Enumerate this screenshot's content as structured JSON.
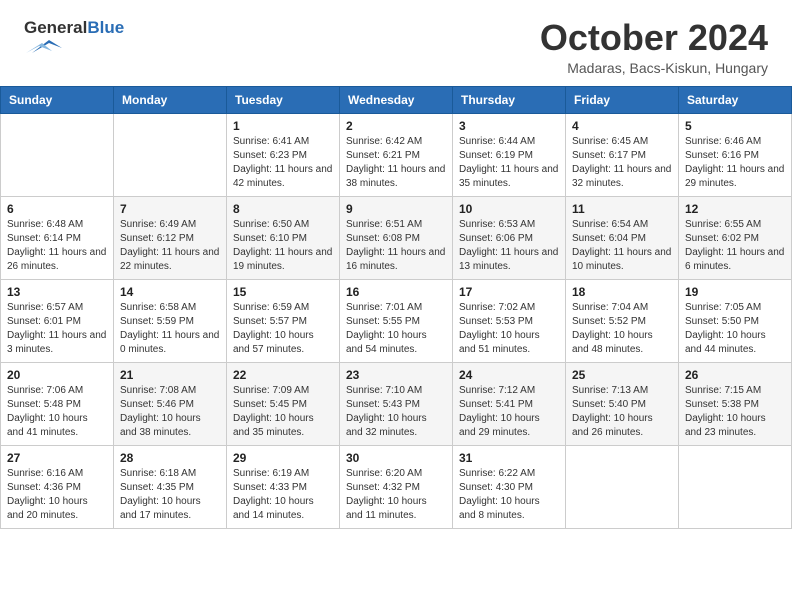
{
  "header": {
    "logo_general": "General",
    "logo_blue": "Blue",
    "month": "October 2024",
    "location": "Madaras, Bacs-Kiskun, Hungary"
  },
  "days_of_week": [
    "Sunday",
    "Monday",
    "Tuesday",
    "Wednesday",
    "Thursday",
    "Friday",
    "Saturday"
  ],
  "weeks": [
    [
      {
        "num": "",
        "sunrise": "",
        "sunset": "",
        "daylight": ""
      },
      {
        "num": "",
        "sunrise": "",
        "sunset": "",
        "daylight": ""
      },
      {
        "num": "1",
        "sunrise": "Sunrise: 6:41 AM",
        "sunset": "Sunset: 6:23 PM",
        "daylight": "Daylight: 11 hours and 42 minutes."
      },
      {
        "num": "2",
        "sunrise": "Sunrise: 6:42 AM",
        "sunset": "Sunset: 6:21 PM",
        "daylight": "Daylight: 11 hours and 38 minutes."
      },
      {
        "num": "3",
        "sunrise": "Sunrise: 6:44 AM",
        "sunset": "Sunset: 6:19 PM",
        "daylight": "Daylight: 11 hours and 35 minutes."
      },
      {
        "num": "4",
        "sunrise": "Sunrise: 6:45 AM",
        "sunset": "Sunset: 6:17 PM",
        "daylight": "Daylight: 11 hours and 32 minutes."
      },
      {
        "num": "5",
        "sunrise": "Sunrise: 6:46 AM",
        "sunset": "Sunset: 6:16 PM",
        "daylight": "Daylight: 11 hours and 29 minutes."
      }
    ],
    [
      {
        "num": "6",
        "sunrise": "Sunrise: 6:48 AM",
        "sunset": "Sunset: 6:14 PM",
        "daylight": "Daylight: 11 hours and 26 minutes."
      },
      {
        "num": "7",
        "sunrise": "Sunrise: 6:49 AM",
        "sunset": "Sunset: 6:12 PM",
        "daylight": "Daylight: 11 hours and 22 minutes."
      },
      {
        "num": "8",
        "sunrise": "Sunrise: 6:50 AM",
        "sunset": "Sunset: 6:10 PM",
        "daylight": "Daylight: 11 hours and 19 minutes."
      },
      {
        "num": "9",
        "sunrise": "Sunrise: 6:51 AM",
        "sunset": "Sunset: 6:08 PM",
        "daylight": "Daylight: 11 hours and 16 minutes."
      },
      {
        "num": "10",
        "sunrise": "Sunrise: 6:53 AM",
        "sunset": "Sunset: 6:06 PM",
        "daylight": "Daylight: 11 hours and 13 minutes."
      },
      {
        "num": "11",
        "sunrise": "Sunrise: 6:54 AM",
        "sunset": "Sunset: 6:04 PM",
        "daylight": "Daylight: 11 hours and 10 minutes."
      },
      {
        "num": "12",
        "sunrise": "Sunrise: 6:55 AM",
        "sunset": "Sunset: 6:02 PM",
        "daylight": "Daylight: 11 hours and 6 minutes."
      }
    ],
    [
      {
        "num": "13",
        "sunrise": "Sunrise: 6:57 AM",
        "sunset": "Sunset: 6:01 PM",
        "daylight": "Daylight: 11 hours and 3 minutes."
      },
      {
        "num": "14",
        "sunrise": "Sunrise: 6:58 AM",
        "sunset": "Sunset: 5:59 PM",
        "daylight": "Daylight: 11 hours and 0 minutes."
      },
      {
        "num": "15",
        "sunrise": "Sunrise: 6:59 AM",
        "sunset": "Sunset: 5:57 PM",
        "daylight": "Daylight: 10 hours and 57 minutes."
      },
      {
        "num": "16",
        "sunrise": "Sunrise: 7:01 AM",
        "sunset": "Sunset: 5:55 PM",
        "daylight": "Daylight: 10 hours and 54 minutes."
      },
      {
        "num": "17",
        "sunrise": "Sunrise: 7:02 AM",
        "sunset": "Sunset: 5:53 PM",
        "daylight": "Daylight: 10 hours and 51 minutes."
      },
      {
        "num": "18",
        "sunrise": "Sunrise: 7:04 AM",
        "sunset": "Sunset: 5:52 PM",
        "daylight": "Daylight: 10 hours and 48 minutes."
      },
      {
        "num": "19",
        "sunrise": "Sunrise: 7:05 AM",
        "sunset": "Sunset: 5:50 PM",
        "daylight": "Daylight: 10 hours and 44 minutes."
      }
    ],
    [
      {
        "num": "20",
        "sunrise": "Sunrise: 7:06 AM",
        "sunset": "Sunset: 5:48 PM",
        "daylight": "Daylight: 10 hours and 41 minutes."
      },
      {
        "num": "21",
        "sunrise": "Sunrise: 7:08 AM",
        "sunset": "Sunset: 5:46 PM",
        "daylight": "Daylight: 10 hours and 38 minutes."
      },
      {
        "num": "22",
        "sunrise": "Sunrise: 7:09 AM",
        "sunset": "Sunset: 5:45 PM",
        "daylight": "Daylight: 10 hours and 35 minutes."
      },
      {
        "num": "23",
        "sunrise": "Sunrise: 7:10 AM",
        "sunset": "Sunset: 5:43 PM",
        "daylight": "Daylight: 10 hours and 32 minutes."
      },
      {
        "num": "24",
        "sunrise": "Sunrise: 7:12 AM",
        "sunset": "Sunset: 5:41 PM",
        "daylight": "Daylight: 10 hours and 29 minutes."
      },
      {
        "num": "25",
        "sunrise": "Sunrise: 7:13 AM",
        "sunset": "Sunset: 5:40 PM",
        "daylight": "Daylight: 10 hours and 26 minutes."
      },
      {
        "num": "26",
        "sunrise": "Sunrise: 7:15 AM",
        "sunset": "Sunset: 5:38 PM",
        "daylight": "Daylight: 10 hours and 23 minutes."
      }
    ],
    [
      {
        "num": "27",
        "sunrise": "Sunrise: 6:16 AM",
        "sunset": "Sunset: 4:36 PM",
        "daylight": "Daylight: 10 hours and 20 minutes."
      },
      {
        "num": "28",
        "sunrise": "Sunrise: 6:18 AM",
        "sunset": "Sunset: 4:35 PM",
        "daylight": "Daylight: 10 hours and 17 minutes."
      },
      {
        "num": "29",
        "sunrise": "Sunrise: 6:19 AM",
        "sunset": "Sunset: 4:33 PM",
        "daylight": "Daylight: 10 hours and 14 minutes."
      },
      {
        "num": "30",
        "sunrise": "Sunrise: 6:20 AM",
        "sunset": "Sunset: 4:32 PM",
        "daylight": "Daylight: 10 hours and 11 minutes."
      },
      {
        "num": "31",
        "sunrise": "Sunrise: 6:22 AM",
        "sunset": "Sunset: 4:30 PM",
        "daylight": "Daylight: 10 hours and 8 minutes."
      },
      {
        "num": "",
        "sunrise": "",
        "sunset": "",
        "daylight": ""
      },
      {
        "num": "",
        "sunrise": "",
        "sunset": "",
        "daylight": ""
      }
    ]
  ]
}
